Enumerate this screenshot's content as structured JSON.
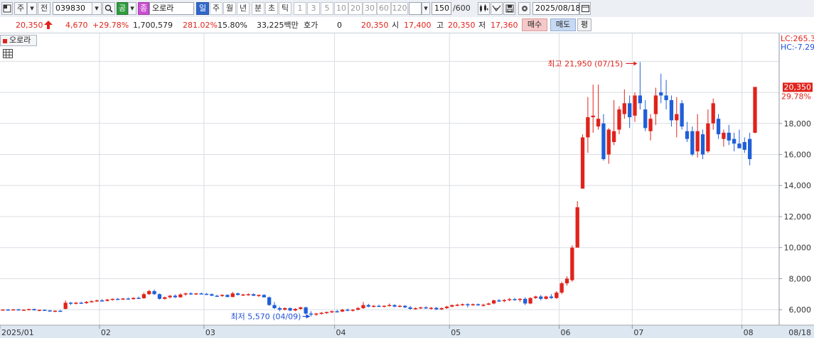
{
  "toolbar": {
    "market_label": "주",
    "all_label": "전",
    "code_value": "039830",
    "type_label": "공",
    "stock_badge": "종",
    "stock_name": "오로라",
    "period_tabs": [
      "일",
      "주",
      "월",
      "년",
      "분",
      "초",
      "틱"
    ],
    "minute_tabs": [
      "1",
      "3",
      "5",
      "10",
      "20",
      "30",
      "60",
      "120"
    ],
    "count_value": "150",
    "count_total": "/600",
    "date_value": "2025/08/18"
  },
  "quote": {
    "price": "20,350",
    "change": "4,670",
    "change_pct": "+29.78%",
    "volume": "1,700,579",
    "volume_ratio": "281.02%",
    "turnover": "15.80%",
    "trade_value": "33,225백만",
    "hoga_label": "호가",
    "hoga_value": "0",
    "hoga_price": "20,350",
    "open_label": "시",
    "open_value": "17,400",
    "high_label": "고",
    "high_value": "20,350",
    "low_label": "저",
    "low_value": "17,360",
    "buy_label": "매수",
    "sell_label": "매도",
    "avg_label": "평"
  },
  "chart_data": {
    "type": "candlestick",
    "legend_name": "오로라",
    "x_date_labels": [
      "2025/01",
      "02",
      "03",
      "04",
      "05",
      "06",
      "07",
      "08",
      "08/18"
    ],
    "y_ticks": [
      "6,000",
      "8,000",
      "10,000",
      "12,000",
      "14,000",
      "16,000",
      "18,000"
    ],
    "ylim": [
      5000,
      23800
    ],
    "current_price_label": "20,350",
    "current_change_label": "29.78%",
    "lc_label": "LC:265.3",
    "hc_label": "HC:-7.29",
    "max_annotation": "최고 21,950 (07/15)",
    "min_annotation": "최저 5,570 (04/09)",
    "colors": {
      "up": "#e0231b",
      "down": "#1f5fd8",
      "grid": "#d9dde3"
    },
    "candles": [
      {
        "o": 5990,
        "h": 6030,
        "l": 5950,
        "c": 6010
      },
      {
        "o": 6010,
        "h": 6050,
        "l": 5960,
        "c": 5990
      },
      {
        "o": 5990,
        "h": 6040,
        "l": 5950,
        "c": 6020
      },
      {
        "o": 6020,
        "h": 6060,
        "l": 5960,
        "c": 5980
      },
      {
        "o": 5980,
        "h": 6030,
        "l": 5950,
        "c": 6000
      },
      {
        "o": 6000,
        "h": 6060,
        "l": 5960,
        "c": 6040
      },
      {
        "o": 6040,
        "h": 6070,
        "l": 5950,
        "c": 5960
      },
      {
        "o": 5960,
        "h": 6000,
        "l": 5900,
        "c": 5990
      },
      {
        "o": 5990,
        "h": 6020,
        "l": 5930,
        "c": 5950
      },
      {
        "o": 5950,
        "h": 5990,
        "l": 5880,
        "c": 5900
      },
      {
        "o": 5900,
        "h": 5960,
        "l": 5850,
        "c": 5930
      },
      {
        "o": 5930,
        "h": 5980,
        "l": 5870,
        "c": 5900
      },
      {
        "o": 6050,
        "h": 6600,
        "l": 6020,
        "c": 6450
      },
      {
        "o": 6450,
        "h": 6500,
        "l": 6300,
        "c": 6380
      },
      {
        "o": 6380,
        "h": 6500,
        "l": 6340,
        "c": 6450
      },
      {
        "o": 6450,
        "h": 6520,
        "l": 6380,
        "c": 6420
      },
      {
        "o": 6420,
        "h": 6560,
        "l": 6380,
        "c": 6500
      },
      {
        "o": 6500,
        "h": 6600,
        "l": 6450,
        "c": 6550
      },
      {
        "o": 6550,
        "h": 6650,
        "l": 6500,
        "c": 6600
      },
      {
        "o": 6600,
        "h": 6680,
        "l": 6520,
        "c": 6570
      },
      {
        "o": 6570,
        "h": 6700,
        "l": 6530,
        "c": 6650
      },
      {
        "o": 6650,
        "h": 6720,
        "l": 6580,
        "c": 6700
      },
      {
        "o": 6700,
        "h": 6750,
        "l": 6620,
        "c": 6660
      },
      {
        "o": 6660,
        "h": 6760,
        "l": 6620,
        "c": 6720
      },
      {
        "o": 6720,
        "h": 6780,
        "l": 6650,
        "c": 6680
      },
      {
        "o": 6680,
        "h": 6800,
        "l": 6650,
        "c": 6760
      },
      {
        "o": 6760,
        "h": 6850,
        "l": 6700,
        "c": 6740
      },
      {
        "o": 6740,
        "h": 7100,
        "l": 6700,
        "c": 7000
      },
      {
        "o": 7000,
        "h": 7280,
        "l": 6950,
        "c": 7200
      },
      {
        "o": 7200,
        "h": 7300,
        "l": 6950,
        "c": 7000
      },
      {
        "o": 7000,
        "h": 7050,
        "l": 6650,
        "c": 6700
      },
      {
        "o": 6700,
        "h": 6850,
        "l": 6650,
        "c": 6800
      },
      {
        "o": 6800,
        "h": 6950,
        "l": 6720,
        "c": 6900
      },
      {
        "o": 6900,
        "h": 6980,
        "l": 6750,
        "c": 6800
      },
      {
        "o": 6800,
        "h": 7050,
        "l": 6780,
        "c": 6980
      },
      {
        "o": 6980,
        "h": 7100,
        "l": 6900,
        "c": 7050
      },
      {
        "o": 7050,
        "h": 7120,
        "l": 6950,
        "c": 7000
      },
      {
        "o": 7000,
        "h": 7080,
        "l": 6950,
        "c": 7050
      },
      {
        "o": 7050,
        "h": 7100,
        "l": 6980,
        "c": 7020
      },
      {
        "o": 7020,
        "h": 7080,
        "l": 6960,
        "c": 7000
      },
      {
        "o": 7000,
        "h": 7050,
        "l": 6880,
        "c": 6900
      },
      {
        "o": 6900,
        "h": 6960,
        "l": 6820,
        "c": 6880
      },
      {
        "o": 6880,
        "h": 7000,
        "l": 6830,
        "c": 6950
      },
      {
        "o": 6950,
        "h": 7000,
        "l": 6800,
        "c": 6820
      },
      {
        "o": 6820,
        "h": 7150,
        "l": 6800,
        "c": 7050
      },
      {
        "o": 7050,
        "h": 7100,
        "l": 6920,
        "c": 6950
      },
      {
        "o": 6950,
        "h": 7020,
        "l": 6880,
        "c": 6980
      },
      {
        "o": 6980,
        "h": 7050,
        "l": 6900,
        "c": 7000
      },
      {
        "o": 7000,
        "h": 7050,
        "l": 6880,
        "c": 6900
      },
      {
        "o": 6900,
        "h": 6980,
        "l": 6820,
        "c": 6950
      },
      {
        "o": 6950,
        "h": 7000,
        "l": 6780,
        "c": 6800
      },
      {
        "o": 6800,
        "h": 6850,
        "l": 6250,
        "c": 6300
      },
      {
        "o": 6300,
        "h": 6500,
        "l": 6050,
        "c": 6100
      },
      {
        "o": 6100,
        "h": 6200,
        "l": 5900,
        "c": 6000
      },
      {
        "o": 6000,
        "h": 6150,
        "l": 5950,
        "c": 6100
      },
      {
        "o": 6100,
        "h": 6150,
        "l": 5900,
        "c": 5950
      },
      {
        "o": 5950,
        "h": 6100,
        "l": 5900,
        "c": 6050
      },
      {
        "o": 6050,
        "h": 6200,
        "l": 6000,
        "c": 6150
      },
      {
        "o": 6150,
        "h": 6200,
        "l": 5700,
        "c": 5750
      },
      {
        "o": 5750,
        "h": 5900,
        "l": 5570,
        "c": 5700
      },
      {
        "o": 5700,
        "h": 5800,
        "l": 5600,
        "c": 5750
      },
      {
        "o": 5750,
        "h": 5850,
        "l": 5680,
        "c": 5800
      },
      {
        "o": 5800,
        "h": 5880,
        "l": 5720,
        "c": 5850
      },
      {
        "o": 5850,
        "h": 5950,
        "l": 5780,
        "c": 5900
      },
      {
        "o": 5900,
        "h": 6000,
        "l": 5820,
        "c": 5880
      },
      {
        "o": 5880,
        "h": 6050,
        "l": 5850,
        "c": 6000
      },
      {
        "o": 6000,
        "h": 6080,
        "l": 5900,
        "c": 5950
      },
      {
        "o": 5950,
        "h": 6050,
        "l": 5880,
        "c": 6000
      },
      {
        "o": 6000,
        "h": 6180,
        "l": 5950,
        "c": 6100
      },
      {
        "o": 6100,
        "h": 6500,
        "l": 6050,
        "c": 6300
      },
      {
        "o": 6300,
        "h": 6380,
        "l": 6150,
        "c": 6200
      },
      {
        "o": 6200,
        "h": 6300,
        "l": 6150,
        "c": 6250
      },
      {
        "o": 6250,
        "h": 6320,
        "l": 6180,
        "c": 6200
      },
      {
        "o": 6200,
        "h": 6280,
        "l": 6150,
        "c": 6250
      },
      {
        "o": 6250,
        "h": 6400,
        "l": 6200,
        "c": 6300
      },
      {
        "o": 6300,
        "h": 6350,
        "l": 6150,
        "c": 6200
      },
      {
        "o": 6200,
        "h": 6300,
        "l": 6150,
        "c": 6250
      },
      {
        "o": 6250,
        "h": 6300,
        "l": 6100,
        "c": 6150
      },
      {
        "o": 6150,
        "h": 6250,
        "l": 6000,
        "c": 6050
      },
      {
        "o": 6050,
        "h": 6150,
        "l": 6000,
        "c": 6100
      },
      {
        "o": 6100,
        "h": 6200,
        "l": 6050,
        "c": 6150
      },
      {
        "o": 6150,
        "h": 6220,
        "l": 6050,
        "c": 6080
      },
      {
        "o": 6080,
        "h": 6180,
        "l": 6000,
        "c": 6120
      },
      {
        "o": 6120,
        "h": 6180,
        "l": 5980,
        "c": 6020
      },
      {
        "o": 6020,
        "h": 6150,
        "l": 5980,
        "c": 6100
      },
      {
        "o": 6100,
        "h": 6250,
        "l": 6050,
        "c": 6200
      },
      {
        "o": 6200,
        "h": 6320,
        "l": 6150,
        "c": 6300
      },
      {
        "o": 6300,
        "h": 6380,
        "l": 6220,
        "c": 6320
      },
      {
        "o": 6320,
        "h": 6400,
        "l": 6250,
        "c": 6350
      },
      {
        "o": 6350,
        "h": 6420,
        "l": 6150,
        "c": 6300
      },
      {
        "o": 6300,
        "h": 6400,
        "l": 6250,
        "c": 6350
      },
      {
        "o": 6350,
        "h": 6400,
        "l": 6250,
        "c": 6280
      },
      {
        "o": 6280,
        "h": 6380,
        "l": 6200,
        "c": 6320
      },
      {
        "o": 6320,
        "h": 6450,
        "l": 6300,
        "c": 6400
      },
      {
        "o": 6400,
        "h": 6650,
        "l": 6350,
        "c": 6600
      },
      {
        "o": 6600,
        "h": 6700,
        "l": 6500,
        "c": 6550
      },
      {
        "o": 6550,
        "h": 6680,
        "l": 6480,
        "c": 6620
      },
      {
        "o": 6620,
        "h": 6750,
        "l": 6550,
        "c": 6680
      },
      {
        "o": 6680,
        "h": 6760,
        "l": 6580,
        "c": 6650
      },
      {
        "o": 6650,
        "h": 6750,
        "l": 6500,
        "c": 6700
      },
      {
        "o": 6700,
        "h": 6800,
        "l": 6300,
        "c": 6400
      },
      {
        "o": 6400,
        "h": 6800,
        "l": 6350,
        "c": 6750
      },
      {
        "o": 6750,
        "h": 6900,
        "l": 6700,
        "c": 6850
      },
      {
        "o": 6850,
        "h": 6950,
        "l": 6600,
        "c": 6700
      },
      {
        "o": 6700,
        "h": 6900,
        "l": 6650,
        "c": 6850
      },
      {
        "o": 6850,
        "h": 7000,
        "l": 6700,
        "c": 6750
      },
      {
        "o": 6750,
        "h": 7200,
        "l": 6700,
        "c": 7100
      },
      {
        "o": 7100,
        "h": 7800,
        "l": 7000,
        "c": 7700
      },
      {
        "o": 7700,
        "h": 8150,
        "l": 7550,
        "c": 8000
      },
      {
        "o": 7900,
        "h": 10150,
        "l": 7800,
        "c": 10000
      },
      {
        "o": 10000,
        "h": 13000,
        "l": 10500,
        "c": 12600
      },
      {
        "o": 13800,
        "h": 17300,
        "l": 13800,
        "c": 17100
      },
      {
        "o": 17100,
        "h": 19700,
        "l": 16100,
        "c": 18400
      },
      {
        "o": 18400,
        "h": 20500,
        "l": 17400,
        "c": 18500
      },
      {
        "o": 17800,
        "h": 20500,
        "l": 17600,
        "c": 18300
      },
      {
        "o": 18000,
        "h": 18600,
        "l": 15600,
        "c": 15700
      },
      {
        "o": 16000,
        "h": 17700,
        "l": 15400,
        "c": 17600
      },
      {
        "o": 16800,
        "h": 19500,
        "l": 16600,
        "c": 17500
      },
      {
        "o": 17600,
        "h": 19100,
        "l": 17300,
        "c": 18900
      },
      {
        "o": 18600,
        "h": 20200,
        "l": 18300,
        "c": 19300
      },
      {
        "o": 19300,
        "h": 19800,
        "l": 17700,
        "c": 18400
      },
      {
        "o": 18500,
        "h": 20000,
        "l": 18100,
        "c": 19800
      },
      {
        "o": 19800,
        "h": 21950,
        "l": 18900,
        "c": 19300
      },
      {
        "o": 18900,
        "h": 19500,
        "l": 17500,
        "c": 17700
      },
      {
        "o": 17500,
        "h": 18600,
        "l": 16900,
        "c": 18300
      },
      {
        "o": 18600,
        "h": 20300,
        "l": 17900,
        "c": 19800
      },
      {
        "o": 20000,
        "h": 21200,
        "l": 19300,
        "c": 19800
      },
      {
        "o": 19800,
        "h": 20800,
        "l": 18900,
        "c": 19500
      },
      {
        "o": 19500,
        "h": 19800,
        "l": 17800,
        "c": 18200
      },
      {
        "o": 18200,
        "h": 19700,
        "l": 17100,
        "c": 18600
      },
      {
        "o": 19300,
        "h": 19500,
        "l": 17600,
        "c": 17800
      },
      {
        "o": 17500,
        "h": 18100,
        "l": 16800,
        "c": 17000
      },
      {
        "o": 17500,
        "h": 17800,
        "l": 15900,
        "c": 16000
      },
      {
        "o": 16200,
        "h": 18600,
        "l": 15800,
        "c": 17500
      },
      {
        "o": 17300,
        "h": 17600,
        "l": 15700,
        "c": 16000
      },
      {
        "o": 16200,
        "h": 18900,
        "l": 16100,
        "c": 18000
      },
      {
        "o": 18000,
        "h": 19600,
        "l": 17600,
        "c": 19300
      },
      {
        "o": 18300,
        "h": 18600,
        "l": 17000,
        "c": 17300
      },
      {
        "o": 17000,
        "h": 17600,
        "l": 16500,
        "c": 17400
      },
      {
        "o": 17400,
        "h": 17900,
        "l": 16600,
        "c": 16900
      },
      {
        "o": 17000,
        "h": 17400,
        "l": 16200,
        "c": 16700
      },
      {
        "o": 16700,
        "h": 17600,
        "l": 16500,
        "c": 16400
      },
      {
        "o": 16800,
        "h": 17100,
        "l": 16100,
        "c": 16300
      },
      {
        "o": 17000,
        "h": 17400,
        "l": 15300,
        "c": 15700
      },
      {
        "o": 17400,
        "h": 20350,
        "l": 17360,
        "c": 20350
      }
    ]
  }
}
